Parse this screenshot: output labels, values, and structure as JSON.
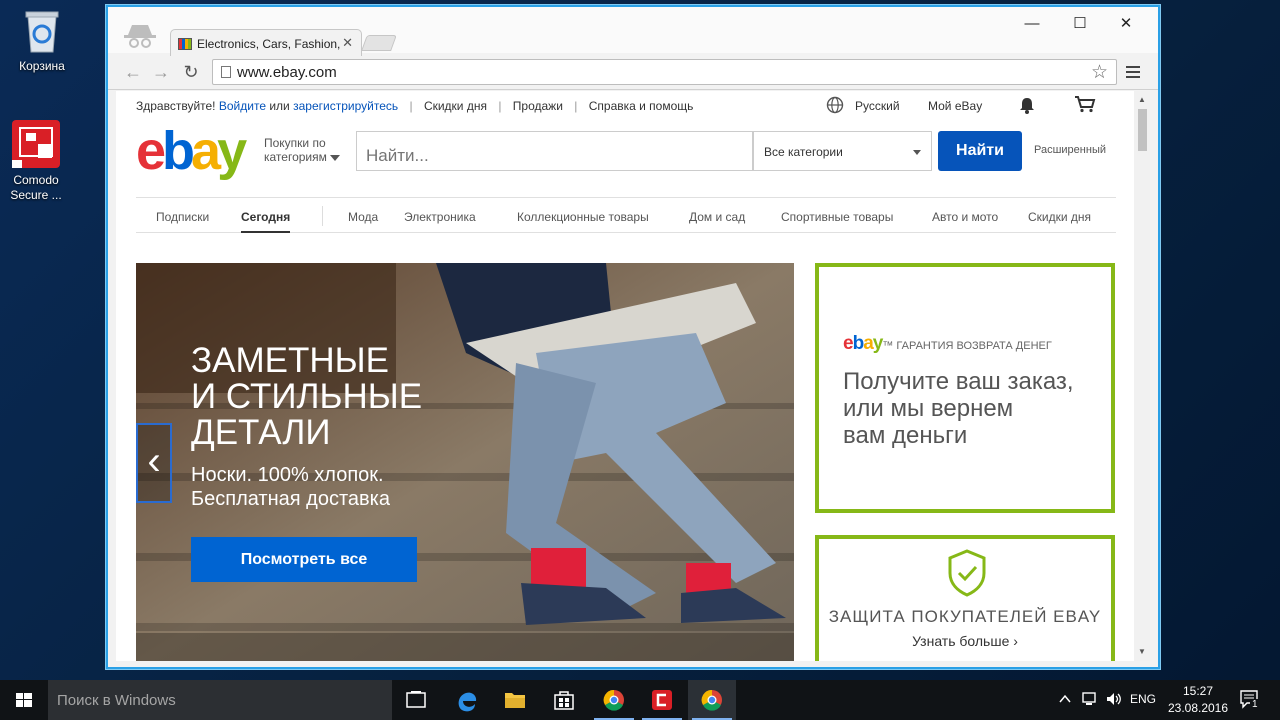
{
  "desktop": {
    "icons": [
      {
        "label": "Корзина"
      },
      {
        "label": "Comodo Secure ..."
      }
    ]
  },
  "browser": {
    "tab_title": "Electronics, Cars, Fashion, ",
    "url": "www.ebay.com"
  },
  "ebay": {
    "header": {
      "greeting": "Здравствуйте!",
      "signin": "Войдите",
      "or": "или",
      "register": "зарегистрируйтесь",
      "daily_deals": "Скидки дня",
      "sell": "Продажи",
      "help": "Справка и помощь",
      "language": "Русский",
      "my_ebay": "Мой eBay"
    },
    "shop_by_category": "Покупки по категориям",
    "search_placeholder": "Найти...",
    "category_select": "Все категории",
    "search_button": "Найти",
    "advanced": "Расширенный",
    "nav": [
      "Подписки",
      "Сегодня",
      "Мода",
      "Электроника",
      "Коллекционные товары",
      "Дом и сад",
      "Спортивные товары",
      "Авто и мото",
      "Скидки дня"
    ],
    "hero": {
      "title_line1": "ЗАМЕТНЫЕ",
      "title_line2": "И СТИЛЬНЫЕ",
      "title_line3": "ДЕТАЛИ",
      "sub_line1": "Носки. 100% хлопок.",
      "sub_line2": "Бесплатная доставка",
      "button": "Посмотреть все",
      "prev_arrow": "‹"
    },
    "guarantee": {
      "logo_text": "ebay",
      "tm": "™",
      "label": "ГАРАНТИЯ ВОЗВРАТА ДЕНЕГ",
      "line1": "Получите ваш заказ,",
      "line2": "или мы вернем",
      "line3": "вам деньги"
    },
    "protection": {
      "title": "ЗАЩИТА ПОКУПАТЕЛЕЙ EBAY",
      "link": "Узнать больше ›"
    }
  },
  "taskbar": {
    "search_placeholder": "Поиск в Windows",
    "lang": "ENG",
    "time": "15:27",
    "date": "23.08.2016",
    "notifications": "1"
  },
  "colors": {
    "ebay_red": "#e53238",
    "ebay_blue": "#0064d2",
    "ebay_yellow": "#f5af02",
    "ebay_green": "#86b817",
    "window_border": "#2aa0e6"
  }
}
